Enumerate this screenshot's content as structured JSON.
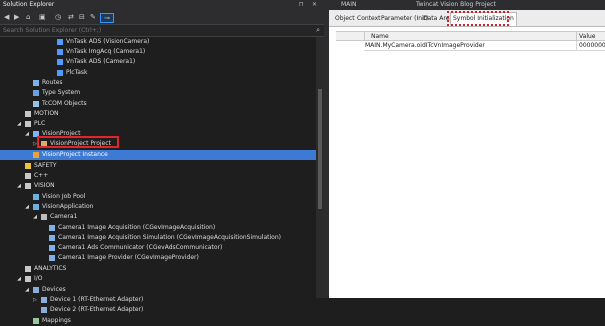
{
  "solution_explorer": {
    "title": "Solution Explorer",
    "pin_glyph": "⊓",
    "close_glyph": "✕",
    "search_placeholder": "Search Solution Explorer (Ctrl+;)",
    "tree": [
      {
        "label": "VnTask ADS (VisionCamera)",
        "arrow": "",
        "icon": "task-icon"
      },
      {
        "label": "VnTask ImgAcq (Camera1)",
        "arrow": "",
        "icon": "task-icon"
      },
      {
        "label": "VnTask ADS (Camera1)",
        "arrow": "",
        "icon": "task-icon"
      },
      {
        "label": "PlcTask",
        "arrow": "",
        "icon": "task-icon"
      },
      {
        "label": "Routes",
        "arrow": "",
        "icon": "routes-icon"
      },
      {
        "label": "Type System",
        "arrow": "",
        "icon": "type-system-icon"
      },
      {
        "label": "TcCOM Objects",
        "arrow": "",
        "icon": "tccom-icon"
      },
      {
        "label": "MOTION",
        "arrow": "",
        "icon": "motion-icon"
      },
      {
        "label": "PLC",
        "arrow": "◢",
        "icon": "plc-icon"
      },
      {
        "label": "VisionProject",
        "arrow": "◢",
        "icon": "plc-project-icon"
      },
      {
        "label": "VisionProject Project",
        "arrow": "▷",
        "icon": "project-icon"
      },
      {
        "label": "VisionProject Instance",
        "arrow": "",
        "icon": "instance-icon",
        "selected": true
      },
      {
        "label": "SAFETY",
        "arrow": "",
        "icon": "safety-icon"
      },
      {
        "label": "C++",
        "arrow": "",
        "icon": "cpp-icon"
      },
      {
        "label": "VISION",
        "arrow": "◢",
        "icon": "vision-icon"
      },
      {
        "label": "Vision Job Pool",
        "arrow": "",
        "icon": "job-pool-icon"
      },
      {
        "label": "VisionApplication",
        "arrow": "◢",
        "icon": "application-icon"
      },
      {
        "label": "Camera1",
        "arrow": "◢",
        "icon": "camera-icon"
      },
      {
        "label": "Camera1 Image Acquisition (CGevImageAcquisition)",
        "arrow": "",
        "icon": "module-icon"
      },
      {
        "label": "Camera1 Image Acquisition Simulation (CGevImageAcquisitionSimulation)",
        "arrow": "",
        "icon": "module-icon"
      },
      {
        "label": "Camera1 Ads Communicator (CGevAdsCommunicator)",
        "arrow": "",
        "icon": "module-icon"
      },
      {
        "label": "Camera1 Image Provider (CGevImageProvider)",
        "arrow": "",
        "icon": "module-icon"
      },
      {
        "label": "ANALYTICS",
        "arrow": "",
        "icon": "analytics-icon"
      },
      {
        "label": "I/O",
        "arrow": "◢",
        "icon": "io-icon"
      },
      {
        "label": "Devices",
        "arrow": "◢",
        "icon": "devices-icon"
      },
      {
        "label": "Device 1 (RT-Ethernet Adapter)",
        "arrow": "▷",
        "icon": "device-icon"
      },
      {
        "label": "Device 2 (RT-Ethernet Adapter)",
        "arrow": "",
        "icon": "device-icon"
      },
      {
        "label": "Mappings",
        "arrow": "",
        "icon": "mappings-icon"
      }
    ]
  },
  "editor": {
    "doc_tab": "MAIN",
    "project_title": "Twincat Vision Blog Project",
    "tabs": [
      "Object",
      "Context",
      "Parameter (Init)",
      "Data Area",
      "Symbol Initialization"
    ],
    "active_tab": "Symbol Initialization",
    "grid": {
      "columns": [
        "Name",
        "Value"
      ],
      "rows": [
        {
          "name": "MAIN.MyCamera.oidITcVnImageProvider",
          "value": "00000000"
        }
      ]
    }
  },
  "colors": {
    "selection": "#3d7ad6",
    "highlight_box": "#e0262a",
    "dark_bg": "#1e1e1e"
  }
}
